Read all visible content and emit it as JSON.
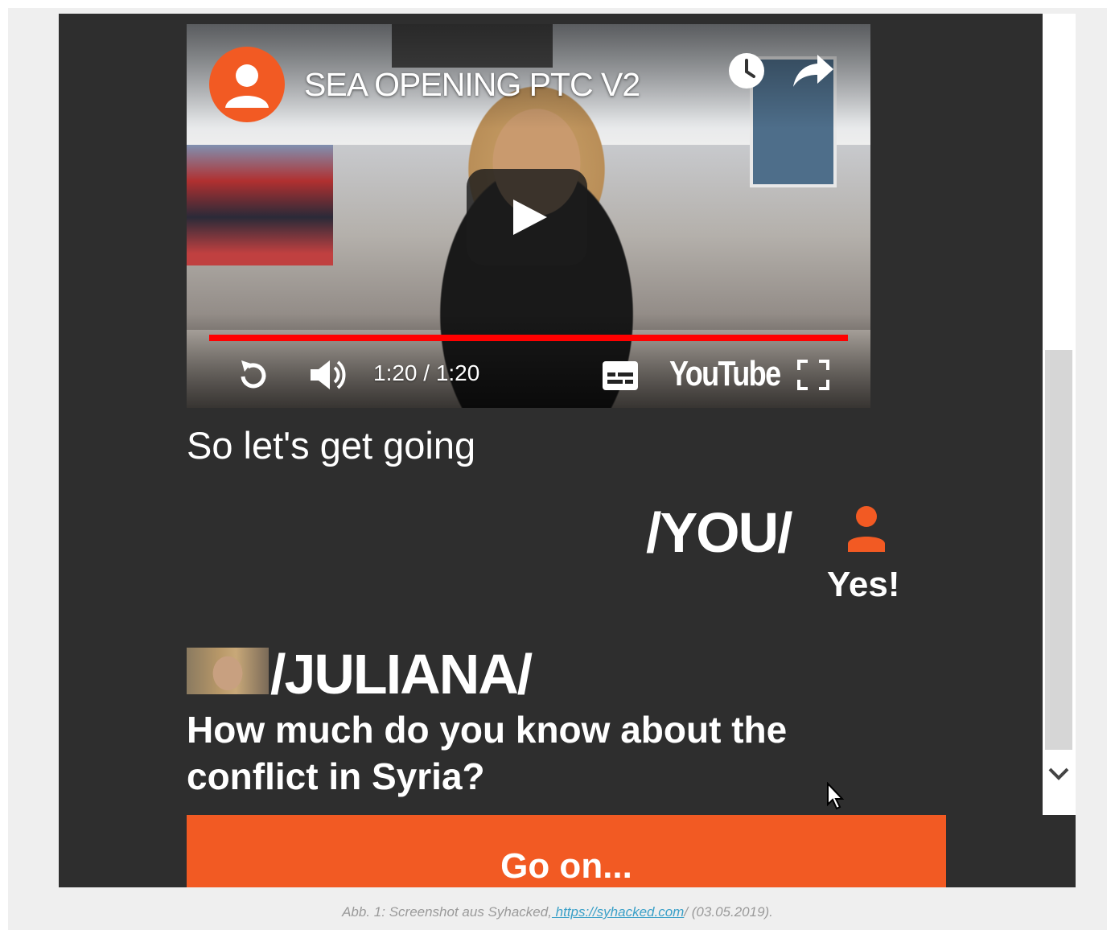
{
  "video": {
    "title": "SEA OPENING PTC V2",
    "timecode": "1:20 / 1:20",
    "platform_logo": "YouTube",
    "progress": 1.0,
    "progress_color": "#ff0000",
    "icons": [
      "channel-avatar-icon",
      "watch-later-icon",
      "share-icon",
      "play-icon",
      "replay-icon",
      "volume-icon",
      "subtitles-icon",
      "fullscreen-icon"
    ]
  },
  "chat": {
    "narration": "So let's get going",
    "you": {
      "label": "/YOU/",
      "reply": "Yes!",
      "icon": "user-icon"
    },
    "juliana": {
      "label": "/JULIANA/",
      "question": "How much do you know about the conflict in Syria?"
    },
    "continue_label": "Go on..."
  },
  "colors": {
    "accent": "#f25a23",
    "background": "#2e2e2e",
    "text": "#ffffff"
  },
  "caption": {
    "prefix": "Abb. 1: Screenshot aus Syhacked,",
    "link": " https://syhacked.com",
    "suffix": "/ (03.05.2019)."
  }
}
